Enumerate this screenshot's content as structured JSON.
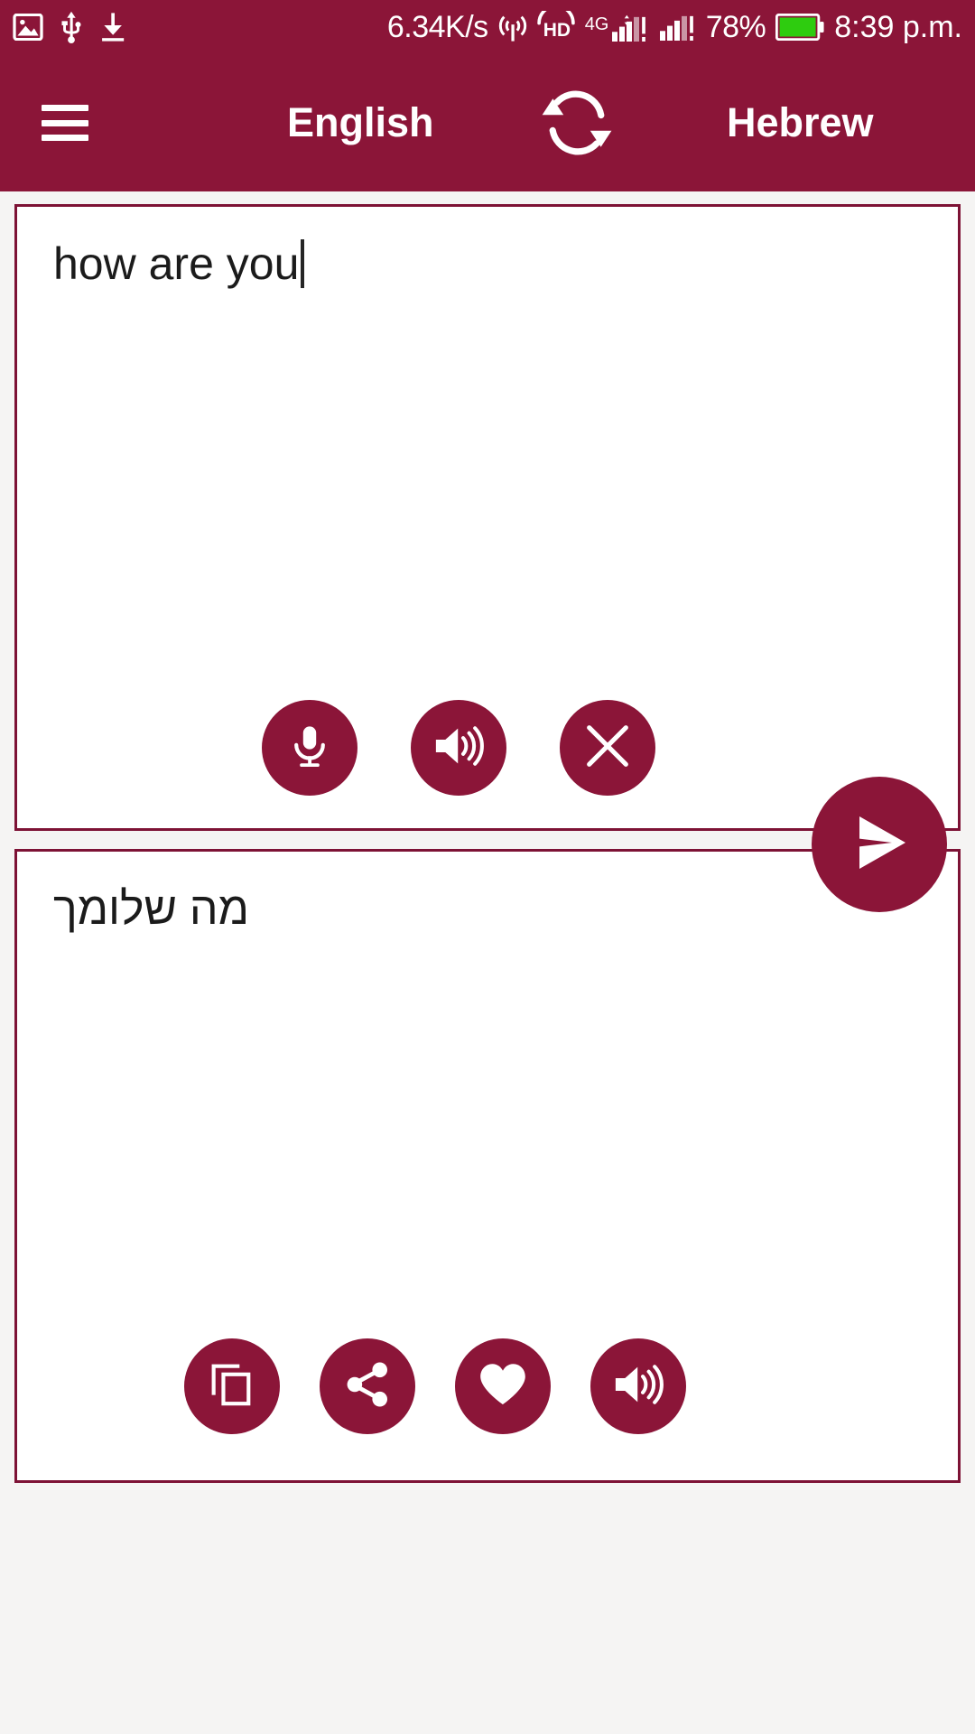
{
  "status_bar": {
    "network_speed": "6.34K/s",
    "battery_percent": "78%",
    "time": "8:39 p.m.",
    "hd_label": "HD",
    "network_type": "4G",
    "left_icons": [
      "image-icon",
      "usb-icon",
      "download-icon"
    ],
    "right_icons": [
      "hotspot-icon",
      "hd-call-icon",
      "signal-4g-icon",
      "signal-2-icon",
      "battery-icon"
    ],
    "colors": {
      "background": "#8b1538",
      "foreground": "#ffffff",
      "battery_fill": "#2ecc0f"
    }
  },
  "app_bar": {
    "menu_icon": "hamburger-menu-icon",
    "source_language": "English",
    "target_language": "Hebrew",
    "swap_icon": "swap-languages-icon",
    "colors": {
      "background": "#8b1538",
      "text": "#ffffff"
    }
  },
  "source_panel": {
    "text": "how are you",
    "has_caret": true,
    "actions": [
      {
        "name": "microphone-button",
        "icon": "microphone-icon"
      },
      {
        "name": "speak-source-button",
        "icon": "speaker-icon"
      },
      {
        "name": "clear-text-button",
        "icon": "close-x-icon"
      }
    ]
  },
  "send_button": {
    "name": "translate-send-button",
    "icon": "send-paper-plane-icon"
  },
  "target_panel": {
    "text": "מה שלומך",
    "direction": "rtl",
    "actions": [
      {
        "name": "copy-button",
        "icon": "copy-icon"
      },
      {
        "name": "share-button",
        "icon": "share-icon"
      },
      {
        "name": "favorite-button",
        "icon": "heart-icon"
      },
      {
        "name": "speak-target-button",
        "icon": "speaker-icon"
      }
    ]
  },
  "theme": {
    "accent": "#8b1538",
    "panel_border": "#7d1235",
    "page_background": "#f5f4f3",
    "panel_background": "#ffffff"
  }
}
